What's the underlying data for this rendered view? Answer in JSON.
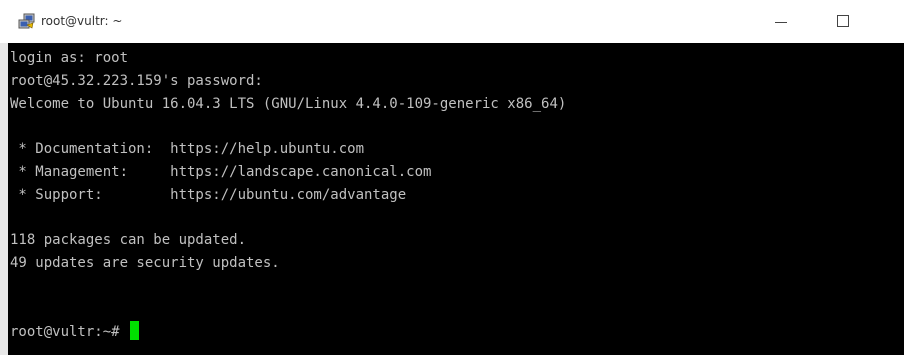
{
  "window": {
    "title": "root@vultr: ~",
    "icon": "putty-icon",
    "controls": {
      "minimize": "minimize-icon",
      "maximize": "maximize-icon"
    }
  },
  "terminal": {
    "background": "#000000",
    "text_color": "#c0c0c0",
    "cursor_color": "#00e000",
    "lines": [
      "login as: root",
      "root@45.32.223.159's password:",
      "Welcome to Ubuntu 16.04.3 LTS (GNU/Linux 4.4.0-109-generic x86_64)",
      "",
      " * Documentation:  https://help.ubuntu.com",
      " * Management:     https://landscape.canonical.com",
      " * Support:        https://ubuntu.com/advantage",
      "",
      "118 packages can be updated.",
      "49 updates are security updates.",
      "",
      "",
      "root@vultr:~#"
    ]
  }
}
